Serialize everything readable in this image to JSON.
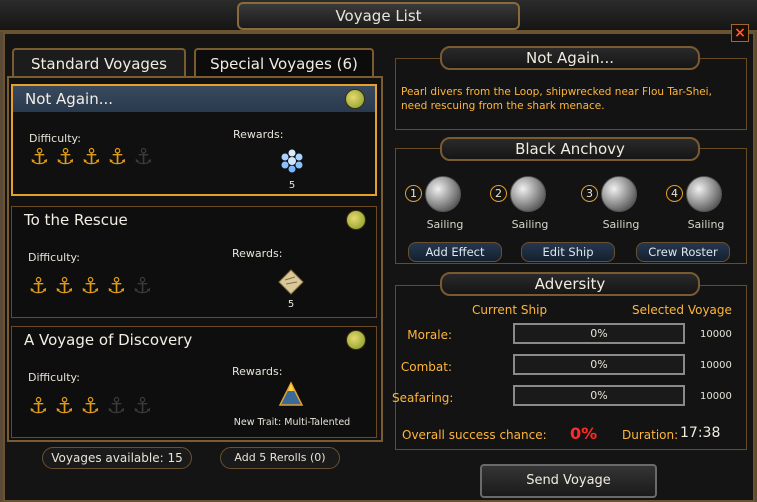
{
  "window_title": "Voyage List",
  "close_glyph": "×",
  "tabs": [
    {
      "label": "Standard Voyages",
      "active": true
    },
    {
      "label": "Special Voyages (6)",
      "active": false
    }
  ],
  "voyages": [
    {
      "title": "Not Again...",
      "difficulty_label": "Difficulty:",
      "difficulty": 4,
      "difficulty_max": 5,
      "rewards_label": "Rewards:",
      "reward_icon": "pearls-icon",
      "reward_value": "5",
      "selected": true
    },
    {
      "title": "To the Rescue",
      "difficulty_label": "Difficulty:",
      "difficulty": 4,
      "difficulty_max": 5,
      "rewards_label": "Rewards:",
      "reward_icon": "scroll-map-icon",
      "reward_value": "5",
      "selected": false
    },
    {
      "title": "A Voyage of Discovery",
      "difficulty_label": "Difficulty:",
      "difficulty": 3,
      "difficulty_max": 5,
      "rewards_label": "Rewards:",
      "reward_icon": "trait-icon",
      "reward_value": "New Trait: Multi-Talented",
      "selected": false
    }
  ],
  "footer": {
    "voyages_available": "Voyages available: 15",
    "rerolls": "Add 5 Rerolls (0)"
  },
  "detail": {
    "title": "Not Again...",
    "description": "Pearl divers from the Loop, shipwrecked near Flou Tar-Shei, need rescuing from the shark menace."
  },
  "ship": {
    "name": "Black Anchovy",
    "crew": [
      {
        "num": "1",
        "skill": "Sailing"
      },
      {
        "num": "2",
        "skill": "Sailing"
      },
      {
        "num": "3",
        "skill": "Sailing"
      },
      {
        "num": "4",
        "skill": "Sailing"
      }
    ],
    "buttons": {
      "add_effect": "Add Effect",
      "edit_ship": "Edit Ship",
      "crew_roster": "Crew Roster"
    }
  },
  "adversity": {
    "title": "Adversity",
    "current_ship_label": "Current Ship",
    "selected_voyage_label": "Selected Voyage",
    "stats": [
      {
        "label": "Morale:",
        "bar_text": "0%",
        "value": "10000"
      },
      {
        "label": "Combat:",
        "bar_text": "0%",
        "value": "10000"
      },
      {
        "label": "Seafaring:",
        "bar_text": "0%",
        "value": "10000"
      }
    ],
    "success_label": "Overall success chance:",
    "success_value": "0%",
    "duration_label": "Duration:",
    "duration_value": "17:38"
  },
  "send_button": "Send Voyage",
  "colors": {
    "accent": "#e3a02a",
    "warning_text": "#ffb63a",
    "success_red": "#ff2a2a"
  }
}
